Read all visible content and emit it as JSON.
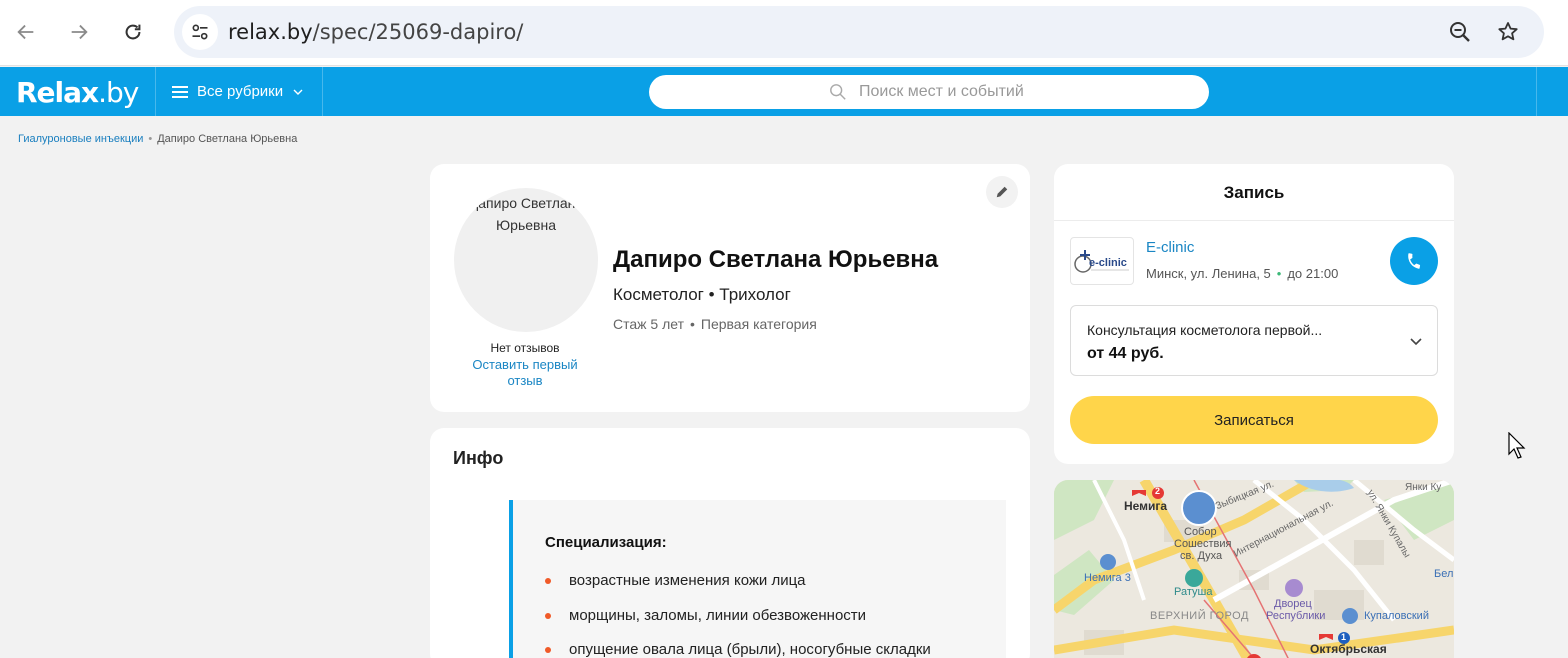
{
  "browser": {
    "url_domain": "relax.by",
    "url_path": "/spec/25069-dapiro/"
  },
  "header": {
    "logo_main": "Relax",
    "logo_suffix": ".by",
    "rubrics_label": "Все рубрики",
    "search_placeholder": "Поиск мест и событий"
  },
  "breadcrumbs": {
    "items": [
      "Гиалуроновые инъекции",
      "Дапиро Светлана Юрьевна"
    ],
    "separator": "•"
  },
  "profile": {
    "avatar_alt": "Дапиро Светлана Юрьевна",
    "name": "Дапиро Светлана Юрьевна",
    "profession": "Косметолог • Трихолог",
    "experience": "Стаж 5 лет",
    "category": "Первая категория",
    "meta_separator": "•",
    "no_reviews": "Нет отзывов",
    "leave_review": "Оставить первый отзыв"
  },
  "info": {
    "title": "Инфо",
    "specialization_title": "Специализация:",
    "specialization_items": [
      "возрастные изменения кожи лица",
      "морщины, заломы, линии обезвоженности",
      "опущение овала лица (брыли), носогубные складки"
    ]
  },
  "booking": {
    "title": "Запись",
    "clinic_name": "E-clinic",
    "clinic_logo_text": "e-clinic",
    "clinic_address": "Минск, ул. Ленина, 5",
    "clinic_hours": "до 21:00",
    "address_separator": "•",
    "service_name": "Консультация косметолога первой...",
    "service_price": "от 44 руб.",
    "book_label": "Записаться"
  },
  "map": {
    "labels": {
      "nemiga": "Немига",
      "nemiga3": "Немига 3",
      "sobor_line1": "Собор",
      "sobor_line2": "Сошествия",
      "sobor_line3": "св. Духа",
      "ratusha": "Ратуша",
      "dvorets_line1": "Дворец",
      "dvorets_line2": "Республики",
      "kupalovsky": "Купаловский",
      "verhny_gorod": "ВЕРХНИЙ ГОРОД",
      "oktyabrskaya": "Октябрьская",
      "internatsionalnaya": "Интернациональная ул.",
      "zybitskaya": "Зыбицкая ул.",
      "yanki_kupaly": "ул. Янки Купалы",
      "yanki_ku": "Янки Ку",
      "bel": "Бел"
    },
    "metro_line_2": "2",
    "metro_line_1": "1",
    "colors": {
      "metro_red": "#e53935",
      "metro_blue": "#1e5fbf",
      "road_yellow": "#f7d56b",
      "park_green": "#cfe6c2"
    }
  }
}
